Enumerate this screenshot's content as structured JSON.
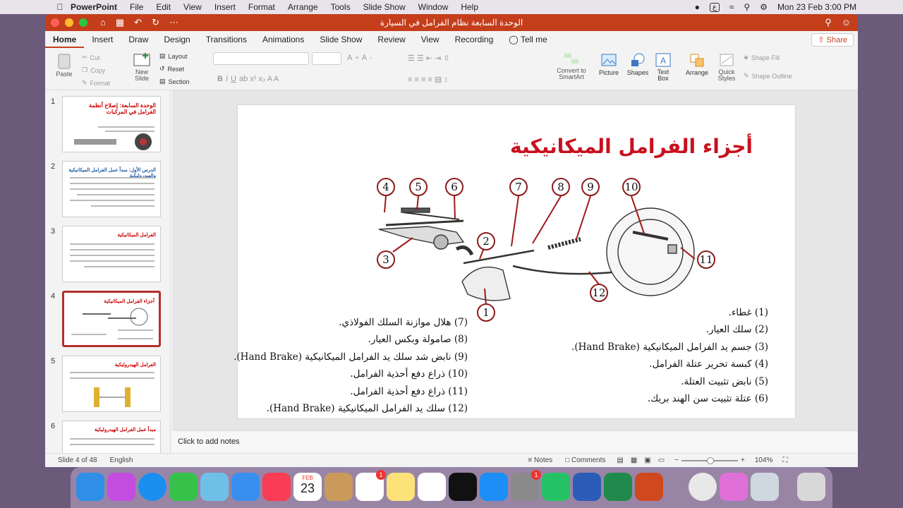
{
  "menubar": {
    "app_name": "PowerPoint",
    "items": [
      "File",
      "Edit",
      "View",
      "Insert",
      "Format",
      "Arrange",
      "Tools",
      "Slide Show",
      "Window",
      "Help"
    ],
    "status_input": "ع",
    "datetime": "Mon 23 Feb  3:00 PM"
  },
  "window": {
    "doc_title": "الوحدة السابعة نظام الفرامل في السيارة",
    "tabs": [
      "Home",
      "Insert",
      "Draw",
      "Design",
      "Transitions",
      "Animations",
      "Slide Show",
      "Review",
      "View",
      "Recording"
    ],
    "tell_me": "Tell me",
    "share": "Share"
  },
  "ribbon": {
    "paste": "Paste",
    "cut": "Cut",
    "copy": "Copy",
    "format": "Format",
    "new_slide": "New\nSlide",
    "layout": "Layout",
    "reset": "Reset",
    "section": "Section",
    "convert": "Convert to\nSmartArt",
    "picture": "Picture",
    "shapes": "Shapes",
    "text_box": "Text\nBox",
    "arrange": "Arrange",
    "quick_styles": "Quick\nStyles",
    "shape_fill": "Shape Fill",
    "shape_outline": "Shape Outline"
  },
  "thumbnails": [
    {
      "num": "1",
      "title": "الوحدة السابعة: إصلاح أنظمة الفرامل في المركبات"
    },
    {
      "num": "2",
      "title": "الدرس الأول: مبدأ عمل الفرامل الميكانيكية والهيدروليكية"
    },
    {
      "num": "3",
      "title": "الفرامل الميكانيكية"
    },
    {
      "num": "4",
      "title": "أجزاء الفرامل الميكانيكية"
    },
    {
      "num": "5",
      "title": "الفرامل الهيدروليكية"
    },
    {
      "num": "6",
      "title": "مبدأ عمل الفرامل الهيدروليكية"
    }
  ],
  "slide": {
    "title": "أجزاء الفرامل الميكانيكية",
    "callouts": [
      "1",
      "2",
      "3",
      "4",
      "5",
      "6",
      "7",
      "8",
      "9",
      "10",
      "11",
      "12"
    ],
    "legend_right": [
      "(1)  غطاء.",
      "(2)  سلك العيار.",
      "(3)  جسم يد الفرامل الميكانيكية (Hand Brake).",
      "(4) كبسة تحرير عتلة الفرامل.",
      "(5)  نابض تثبيت العتلة.",
      "(6) عتلة تثبيت سن الهند بريك."
    ],
    "legend_left": [
      "(7)  هلال موازنة السلك الفولاذي.",
      "(8) صامولة وبكس العيار.",
      "(9)  نابض شد سلك يد الفرامل الميكانيكية (Hand Brake).",
      "(10) ذراع دفع أحذية الفرامل.",
      "(11)     ذراع دفع أحذية الفرامل.",
      "(12) سلك يد الفرامل الميكانيكية (Hand Brake)."
    ]
  },
  "notes_placeholder": "Click to add notes",
  "status": {
    "slide_info": "Slide 4 of 48",
    "language": "English",
    "notes": "Notes",
    "comments": "Comments",
    "zoom": "104%"
  },
  "dock": {
    "calendar_month": "FEB",
    "calendar_day": "23",
    "badge": "1"
  },
  "colors": {
    "accent": "#c43e1c",
    "title_red": "#c8101e",
    "callout_border": "#8b1c1c"
  }
}
